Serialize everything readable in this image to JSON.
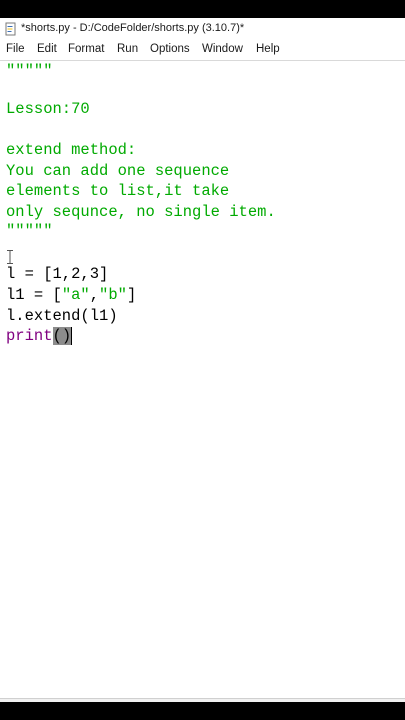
{
  "window": {
    "title": "*shorts.py - D:/CodeFolder/shorts.py (3.10.7)*"
  },
  "menu": {
    "items": [
      "File",
      "Edit",
      "Format",
      "Run",
      "Options",
      "Window",
      "Help"
    ]
  },
  "editor": {
    "lines": {
      "l1": "\"\"\"\"\"",
      "l2": "Lesson:70",
      "l3": "",
      "l4": "extend method:",
      "l5": "You can add one sequence",
      "l6": "elements to list,it take",
      "l7": "only sequnce, no single item.",
      "l8": "\"\"\"\"\"",
      "l9": "",
      "l10": "l = [1,2,3]",
      "l11_a": "l1 = [",
      "l11_b": "\"a\"",
      "l11_c": ",",
      "l11_d": "\"b\"",
      "l11_e": "]",
      "l12": "l.extend(l1)",
      "l13_kw": "print",
      "l13_paren": "()"
    },
    "colors": {
      "string": "#00aa00",
      "builtin": "#800080",
      "default": "#000000"
    }
  }
}
